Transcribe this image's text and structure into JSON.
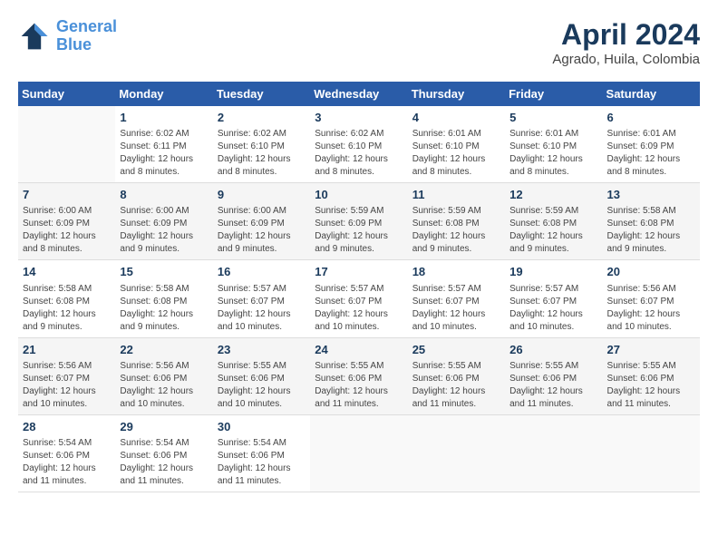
{
  "header": {
    "logo_line1": "General",
    "logo_line2": "Blue",
    "month": "April 2024",
    "location": "Agrado, Huila, Colombia"
  },
  "weekdays": [
    "Sunday",
    "Monday",
    "Tuesday",
    "Wednesday",
    "Thursday",
    "Friday",
    "Saturday"
  ],
  "weeks": [
    [
      {
        "day": "",
        "info": ""
      },
      {
        "day": "1",
        "info": "Sunrise: 6:02 AM\nSunset: 6:11 PM\nDaylight: 12 hours\nand 8 minutes."
      },
      {
        "day": "2",
        "info": "Sunrise: 6:02 AM\nSunset: 6:10 PM\nDaylight: 12 hours\nand 8 minutes."
      },
      {
        "day": "3",
        "info": "Sunrise: 6:02 AM\nSunset: 6:10 PM\nDaylight: 12 hours\nand 8 minutes."
      },
      {
        "day": "4",
        "info": "Sunrise: 6:01 AM\nSunset: 6:10 PM\nDaylight: 12 hours\nand 8 minutes."
      },
      {
        "day": "5",
        "info": "Sunrise: 6:01 AM\nSunset: 6:10 PM\nDaylight: 12 hours\nand 8 minutes."
      },
      {
        "day": "6",
        "info": "Sunrise: 6:01 AM\nSunset: 6:09 PM\nDaylight: 12 hours\nand 8 minutes."
      }
    ],
    [
      {
        "day": "7",
        "info": "Sunrise: 6:00 AM\nSunset: 6:09 PM\nDaylight: 12 hours\nand 8 minutes."
      },
      {
        "day": "8",
        "info": "Sunrise: 6:00 AM\nSunset: 6:09 PM\nDaylight: 12 hours\nand 9 minutes."
      },
      {
        "day": "9",
        "info": "Sunrise: 6:00 AM\nSunset: 6:09 PM\nDaylight: 12 hours\nand 9 minutes."
      },
      {
        "day": "10",
        "info": "Sunrise: 5:59 AM\nSunset: 6:09 PM\nDaylight: 12 hours\nand 9 minutes."
      },
      {
        "day": "11",
        "info": "Sunrise: 5:59 AM\nSunset: 6:08 PM\nDaylight: 12 hours\nand 9 minutes."
      },
      {
        "day": "12",
        "info": "Sunrise: 5:59 AM\nSunset: 6:08 PM\nDaylight: 12 hours\nand 9 minutes."
      },
      {
        "day": "13",
        "info": "Sunrise: 5:58 AM\nSunset: 6:08 PM\nDaylight: 12 hours\nand 9 minutes."
      }
    ],
    [
      {
        "day": "14",
        "info": "Sunrise: 5:58 AM\nSunset: 6:08 PM\nDaylight: 12 hours\nand 9 minutes."
      },
      {
        "day": "15",
        "info": "Sunrise: 5:58 AM\nSunset: 6:08 PM\nDaylight: 12 hours\nand 9 minutes."
      },
      {
        "day": "16",
        "info": "Sunrise: 5:57 AM\nSunset: 6:07 PM\nDaylight: 12 hours\nand 10 minutes."
      },
      {
        "day": "17",
        "info": "Sunrise: 5:57 AM\nSunset: 6:07 PM\nDaylight: 12 hours\nand 10 minutes."
      },
      {
        "day": "18",
        "info": "Sunrise: 5:57 AM\nSunset: 6:07 PM\nDaylight: 12 hours\nand 10 minutes."
      },
      {
        "day": "19",
        "info": "Sunrise: 5:57 AM\nSunset: 6:07 PM\nDaylight: 12 hours\nand 10 minutes."
      },
      {
        "day": "20",
        "info": "Sunrise: 5:56 AM\nSunset: 6:07 PM\nDaylight: 12 hours\nand 10 minutes."
      }
    ],
    [
      {
        "day": "21",
        "info": "Sunrise: 5:56 AM\nSunset: 6:07 PM\nDaylight: 12 hours\nand 10 minutes."
      },
      {
        "day": "22",
        "info": "Sunrise: 5:56 AM\nSunset: 6:06 PM\nDaylight: 12 hours\nand 10 minutes."
      },
      {
        "day": "23",
        "info": "Sunrise: 5:55 AM\nSunset: 6:06 PM\nDaylight: 12 hours\nand 10 minutes."
      },
      {
        "day": "24",
        "info": "Sunrise: 5:55 AM\nSunset: 6:06 PM\nDaylight: 12 hours\nand 11 minutes."
      },
      {
        "day": "25",
        "info": "Sunrise: 5:55 AM\nSunset: 6:06 PM\nDaylight: 12 hours\nand 11 minutes."
      },
      {
        "day": "26",
        "info": "Sunrise: 5:55 AM\nSunset: 6:06 PM\nDaylight: 12 hours\nand 11 minutes."
      },
      {
        "day": "27",
        "info": "Sunrise: 5:55 AM\nSunset: 6:06 PM\nDaylight: 12 hours\nand 11 minutes."
      }
    ],
    [
      {
        "day": "28",
        "info": "Sunrise: 5:54 AM\nSunset: 6:06 PM\nDaylight: 12 hours\nand 11 minutes."
      },
      {
        "day": "29",
        "info": "Sunrise: 5:54 AM\nSunset: 6:06 PM\nDaylight: 12 hours\nand 11 minutes."
      },
      {
        "day": "30",
        "info": "Sunrise: 5:54 AM\nSunset: 6:06 PM\nDaylight: 12 hours\nand 11 minutes."
      },
      {
        "day": "",
        "info": ""
      },
      {
        "day": "",
        "info": ""
      },
      {
        "day": "",
        "info": ""
      },
      {
        "day": "",
        "info": ""
      }
    ]
  ]
}
